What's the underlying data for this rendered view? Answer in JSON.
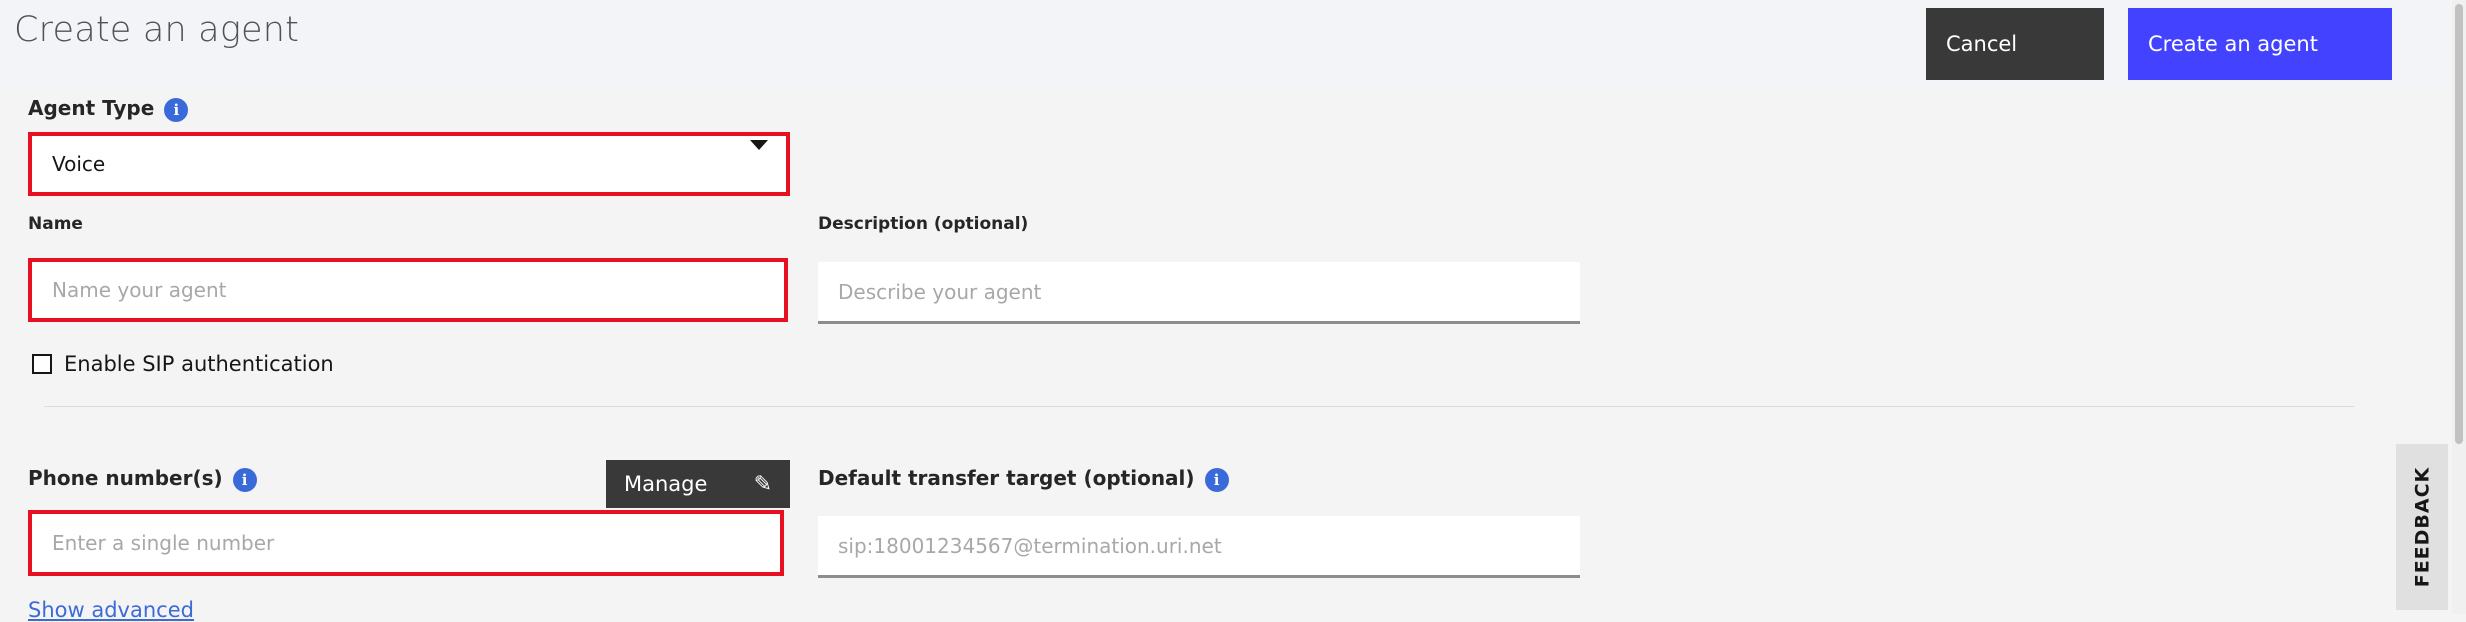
{
  "header": {
    "title": "Create an agent",
    "cancel_label": "Cancel",
    "create_label": "Create an agent"
  },
  "form": {
    "agent_type": {
      "label": "Agent Type",
      "value": "Voice",
      "info_icon": "info-icon"
    },
    "name": {
      "label": "Name",
      "placeholder": "Name your agent"
    },
    "description": {
      "label": "Description (optional)",
      "placeholder": "Describe your agent"
    },
    "sip_auth": {
      "label": "Enable SIP authentication",
      "checked": false
    },
    "phone": {
      "label": "Phone number(s)",
      "placeholder": "Enter a single number",
      "manage_label": "Manage",
      "manage_icon": "pencil-icon"
    },
    "transfer": {
      "label": "Default transfer target (optional)",
      "placeholder": "sip:18001234567@termination.uri.net"
    },
    "show_advanced": "Show advanced"
  },
  "feedback_label": "FEEDBACK",
  "colors": {
    "primary": "#4242ff",
    "secondary_button": "#393939",
    "error_outline": "#e8101f",
    "info": "#3a6ad9"
  }
}
